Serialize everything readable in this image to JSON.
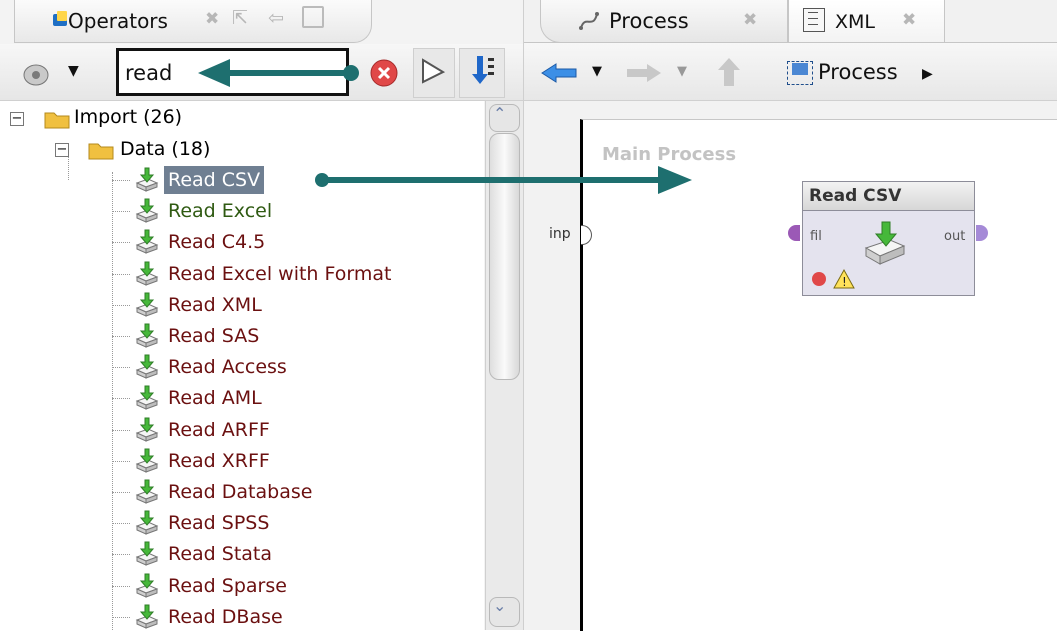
{
  "left": {
    "tab_title": "Operators",
    "search": {
      "value": "read"
    },
    "tree": {
      "import_label": "Import (26)",
      "data_label": "Data (18)",
      "items": [
        "Read CSV",
        "Read Excel",
        "Read C4.5",
        "Read Excel with Format",
        "Read XML",
        "Read SAS",
        "Read Access",
        "Read AML",
        "Read ARFF",
        "Read XRFF",
        "Read Database",
        "Read SPSS",
        "Read Stata",
        "Read Sparse",
        "Read DBase"
      ]
    }
  },
  "right": {
    "tabs": {
      "process": "Process",
      "xml": "XML"
    },
    "breadcrumb": "Process",
    "canvas_title": "Main Process",
    "operator": {
      "title": "Read CSV",
      "in_port": "fil",
      "out_port": "out"
    },
    "main_input": "inp"
  },
  "colors": {
    "arrow": "#1e6f6f",
    "selection": "#6f7f92",
    "folder": "#f0c040"
  }
}
